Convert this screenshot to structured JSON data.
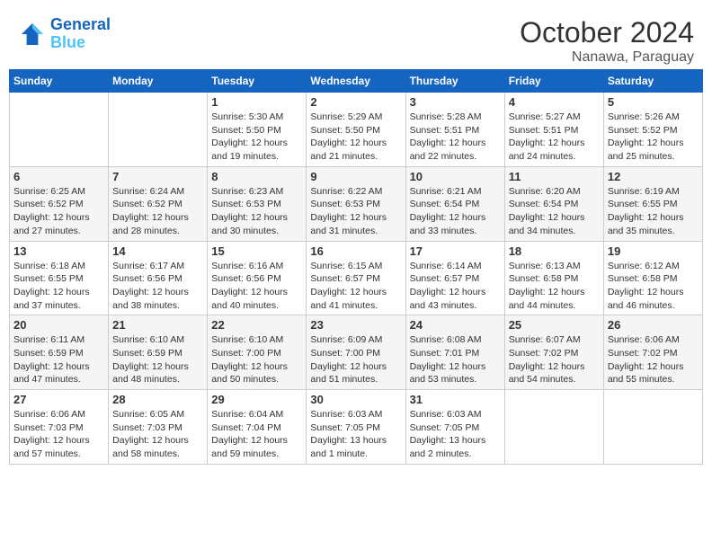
{
  "logo": {
    "line1": "General",
    "line2": "Blue"
  },
  "title": "October 2024",
  "subtitle": "Nanawa, Paraguay",
  "weekdays": [
    "Sunday",
    "Monday",
    "Tuesday",
    "Wednesday",
    "Thursday",
    "Friday",
    "Saturday"
  ],
  "weeks": [
    [
      {
        "day": "",
        "sunrise": "",
        "sunset": "",
        "daylight": ""
      },
      {
        "day": "",
        "sunrise": "",
        "sunset": "",
        "daylight": ""
      },
      {
        "day": "1",
        "sunrise": "Sunrise: 5:30 AM",
        "sunset": "Sunset: 5:50 PM",
        "daylight": "Daylight: 12 hours and 19 minutes."
      },
      {
        "day": "2",
        "sunrise": "Sunrise: 5:29 AM",
        "sunset": "Sunset: 5:50 PM",
        "daylight": "Daylight: 12 hours and 21 minutes."
      },
      {
        "day": "3",
        "sunrise": "Sunrise: 5:28 AM",
        "sunset": "Sunset: 5:51 PM",
        "daylight": "Daylight: 12 hours and 22 minutes."
      },
      {
        "day": "4",
        "sunrise": "Sunrise: 5:27 AM",
        "sunset": "Sunset: 5:51 PM",
        "daylight": "Daylight: 12 hours and 24 minutes."
      },
      {
        "day": "5",
        "sunrise": "Sunrise: 5:26 AM",
        "sunset": "Sunset: 5:52 PM",
        "daylight": "Daylight: 12 hours and 25 minutes."
      }
    ],
    [
      {
        "day": "6",
        "sunrise": "Sunrise: 6:25 AM",
        "sunset": "Sunset: 6:52 PM",
        "daylight": "Daylight: 12 hours and 27 minutes."
      },
      {
        "day": "7",
        "sunrise": "Sunrise: 6:24 AM",
        "sunset": "Sunset: 6:52 PM",
        "daylight": "Daylight: 12 hours and 28 minutes."
      },
      {
        "day": "8",
        "sunrise": "Sunrise: 6:23 AM",
        "sunset": "Sunset: 6:53 PM",
        "daylight": "Daylight: 12 hours and 30 minutes."
      },
      {
        "day": "9",
        "sunrise": "Sunrise: 6:22 AM",
        "sunset": "Sunset: 6:53 PM",
        "daylight": "Daylight: 12 hours and 31 minutes."
      },
      {
        "day": "10",
        "sunrise": "Sunrise: 6:21 AM",
        "sunset": "Sunset: 6:54 PM",
        "daylight": "Daylight: 12 hours and 33 minutes."
      },
      {
        "day": "11",
        "sunrise": "Sunrise: 6:20 AM",
        "sunset": "Sunset: 6:54 PM",
        "daylight": "Daylight: 12 hours and 34 minutes."
      },
      {
        "day": "12",
        "sunrise": "Sunrise: 6:19 AM",
        "sunset": "Sunset: 6:55 PM",
        "daylight": "Daylight: 12 hours and 35 minutes."
      }
    ],
    [
      {
        "day": "13",
        "sunrise": "Sunrise: 6:18 AM",
        "sunset": "Sunset: 6:55 PM",
        "daylight": "Daylight: 12 hours and 37 minutes."
      },
      {
        "day": "14",
        "sunrise": "Sunrise: 6:17 AM",
        "sunset": "Sunset: 6:56 PM",
        "daylight": "Daylight: 12 hours and 38 minutes."
      },
      {
        "day": "15",
        "sunrise": "Sunrise: 6:16 AM",
        "sunset": "Sunset: 6:56 PM",
        "daylight": "Daylight: 12 hours and 40 minutes."
      },
      {
        "day": "16",
        "sunrise": "Sunrise: 6:15 AM",
        "sunset": "Sunset: 6:57 PM",
        "daylight": "Daylight: 12 hours and 41 minutes."
      },
      {
        "day": "17",
        "sunrise": "Sunrise: 6:14 AM",
        "sunset": "Sunset: 6:57 PM",
        "daylight": "Daylight: 12 hours and 43 minutes."
      },
      {
        "day": "18",
        "sunrise": "Sunrise: 6:13 AM",
        "sunset": "Sunset: 6:58 PM",
        "daylight": "Daylight: 12 hours and 44 minutes."
      },
      {
        "day": "19",
        "sunrise": "Sunrise: 6:12 AM",
        "sunset": "Sunset: 6:58 PM",
        "daylight": "Daylight: 12 hours and 46 minutes."
      }
    ],
    [
      {
        "day": "20",
        "sunrise": "Sunrise: 6:11 AM",
        "sunset": "Sunset: 6:59 PM",
        "daylight": "Daylight: 12 hours and 47 minutes."
      },
      {
        "day": "21",
        "sunrise": "Sunrise: 6:10 AM",
        "sunset": "Sunset: 6:59 PM",
        "daylight": "Daylight: 12 hours and 48 minutes."
      },
      {
        "day": "22",
        "sunrise": "Sunrise: 6:10 AM",
        "sunset": "Sunset: 7:00 PM",
        "daylight": "Daylight: 12 hours and 50 minutes."
      },
      {
        "day": "23",
        "sunrise": "Sunrise: 6:09 AM",
        "sunset": "Sunset: 7:00 PM",
        "daylight": "Daylight: 12 hours and 51 minutes."
      },
      {
        "day": "24",
        "sunrise": "Sunrise: 6:08 AM",
        "sunset": "Sunset: 7:01 PM",
        "daylight": "Daylight: 12 hours and 53 minutes."
      },
      {
        "day": "25",
        "sunrise": "Sunrise: 6:07 AM",
        "sunset": "Sunset: 7:02 PM",
        "daylight": "Daylight: 12 hours and 54 minutes."
      },
      {
        "day": "26",
        "sunrise": "Sunrise: 6:06 AM",
        "sunset": "Sunset: 7:02 PM",
        "daylight": "Daylight: 12 hours and 55 minutes."
      }
    ],
    [
      {
        "day": "27",
        "sunrise": "Sunrise: 6:06 AM",
        "sunset": "Sunset: 7:03 PM",
        "daylight": "Daylight: 12 hours and 57 minutes."
      },
      {
        "day": "28",
        "sunrise": "Sunrise: 6:05 AM",
        "sunset": "Sunset: 7:03 PM",
        "daylight": "Daylight: 12 hours and 58 minutes."
      },
      {
        "day": "29",
        "sunrise": "Sunrise: 6:04 AM",
        "sunset": "Sunset: 7:04 PM",
        "daylight": "Daylight: 12 hours and 59 minutes."
      },
      {
        "day": "30",
        "sunrise": "Sunrise: 6:03 AM",
        "sunset": "Sunset: 7:05 PM",
        "daylight": "Daylight: 13 hours and 1 minute."
      },
      {
        "day": "31",
        "sunrise": "Sunrise: 6:03 AM",
        "sunset": "Sunset: 7:05 PM",
        "daylight": "Daylight: 13 hours and 2 minutes."
      },
      {
        "day": "",
        "sunrise": "",
        "sunset": "",
        "daylight": ""
      },
      {
        "day": "",
        "sunrise": "",
        "sunset": "",
        "daylight": ""
      }
    ]
  ]
}
